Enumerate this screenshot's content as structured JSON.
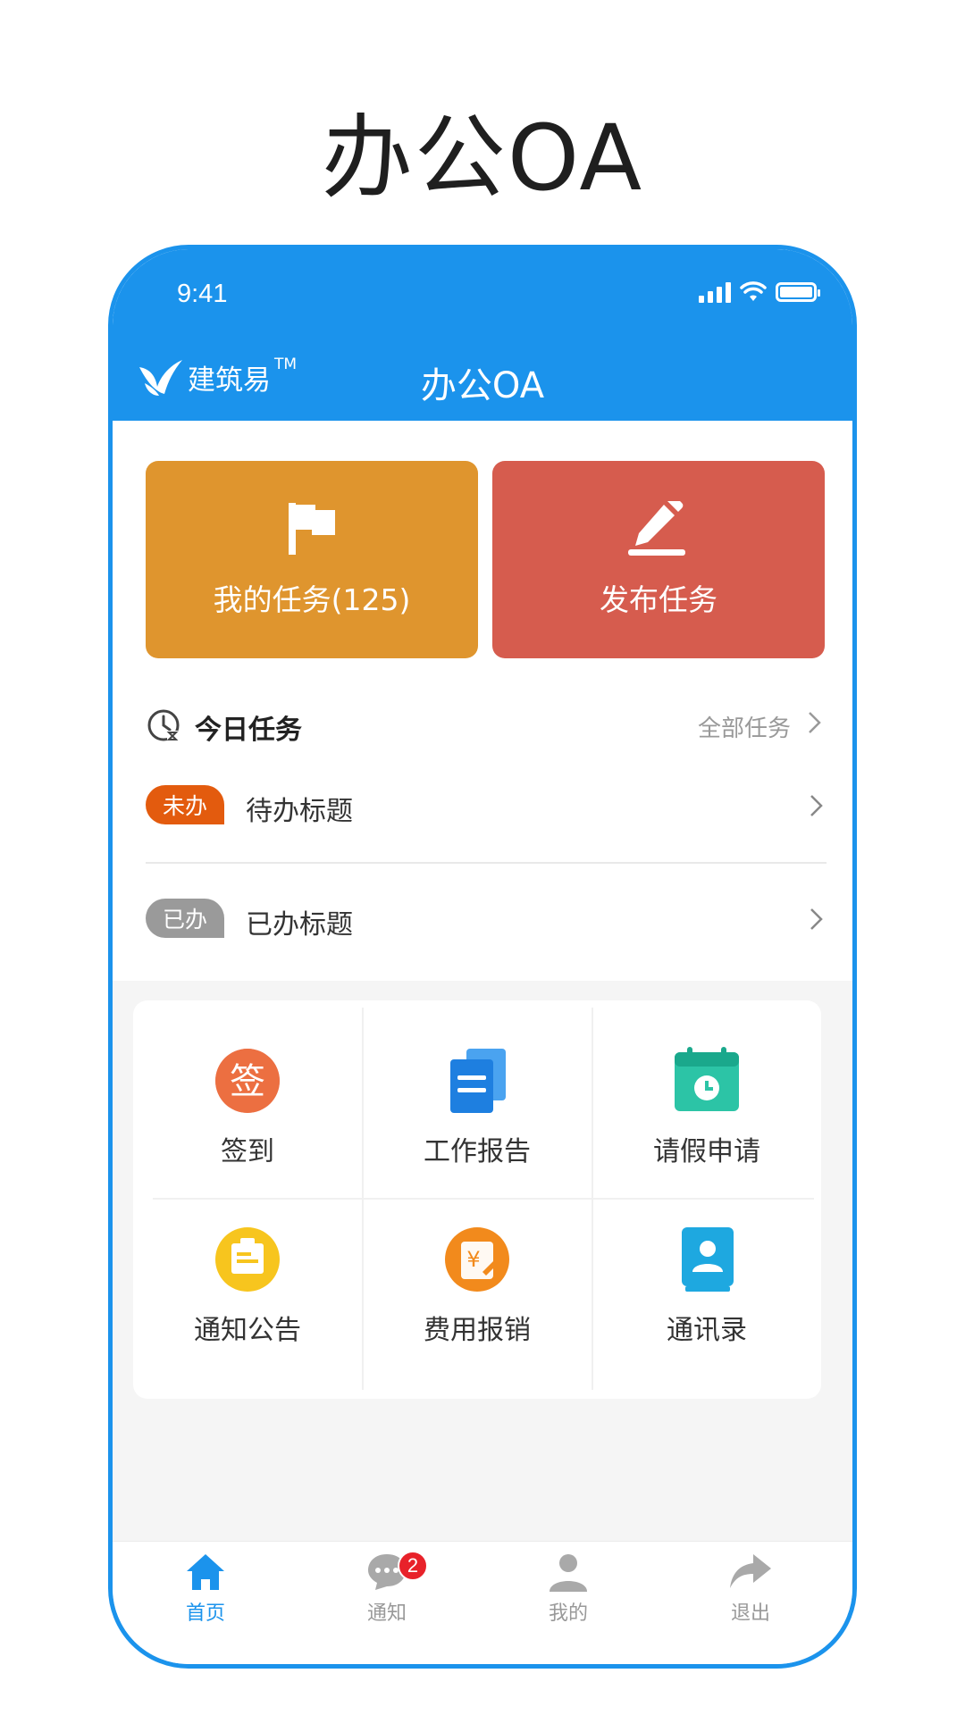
{
  "page_title": "办公OA",
  "status_bar": {
    "time": "9:41"
  },
  "header": {
    "brand_name": "建筑易",
    "brand_tm": "TM",
    "title": "办公OA"
  },
  "quick_actions": [
    {
      "label": "我的任务(125)",
      "icon": "flag-icon",
      "color": "#df952e"
    },
    {
      "label": "发布任务",
      "icon": "pencil-icon",
      "color": "#d65c4e"
    }
  ],
  "today_tasks": {
    "title": "今日任务",
    "more_label": "全部任务",
    "items": [
      {
        "badge": "未办",
        "title": "待办标题",
        "badge_color": "#e35b0e"
      },
      {
        "badge": "已办",
        "title": "已办标题",
        "badge_color": "#9a9a9a"
      }
    ]
  },
  "grid": [
    {
      "label": "签到",
      "icon": "sign-in-icon"
    },
    {
      "label": "工作报告",
      "icon": "report-icon"
    },
    {
      "label": "请假申请",
      "icon": "calendar-leave-icon"
    },
    {
      "label": "通知公告",
      "icon": "announcement-icon"
    },
    {
      "label": "费用报销",
      "icon": "expense-icon"
    },
    {
      "label": "通讯录",
      "icon": "contacts-icon"
    }
  ],
  "tabbar": [
    {
      "label": "首页",
      "icon": "home-icon",
      "active": true
    },
    {
      "label": "通知",
      "icon": "chat-icon",
      "badge": "2"
    },
    {
      "label": "我的",
      "icon": "user-icon"
    },
    {
      "label": "退出",
      "icon": "exit-icon"
    }
  ]
}
